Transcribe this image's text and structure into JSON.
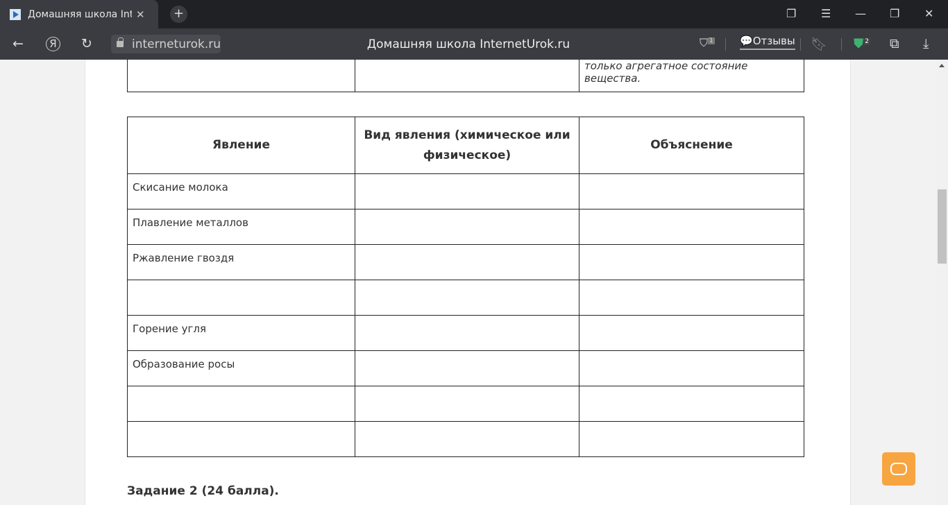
{
  "browser": {
    "tab_title": "Домашняя школа InternetUrok.ru",
    "url": "interneturok.ru",
    "page_title": "Домашняя школа InternetUrok.ru",
    "reviews_label": "Отзывы",
    "protect_badge": "1",
    "ext_badge": "2"
  },
  "content": {
    "prev_table_fragment": "только агрегатное состояние вещества.",
    "table": {
      "headers": [
        "Явление",
        "Вид явления (химическое или физическое)",
        "Объяснение"
      ],
      "rows": [
        "Скисание молока",
        "Плавление металлов",
        "Ржавление гвоздя",
        "",
        "Горение угля",
        "Образование росы",
        "",
        ""
      ]
    },
    "next_task": "Задание 2 (24 балла)."
  },
  "colors": {
    "accent_chat": "#f7a541"
  }
}
